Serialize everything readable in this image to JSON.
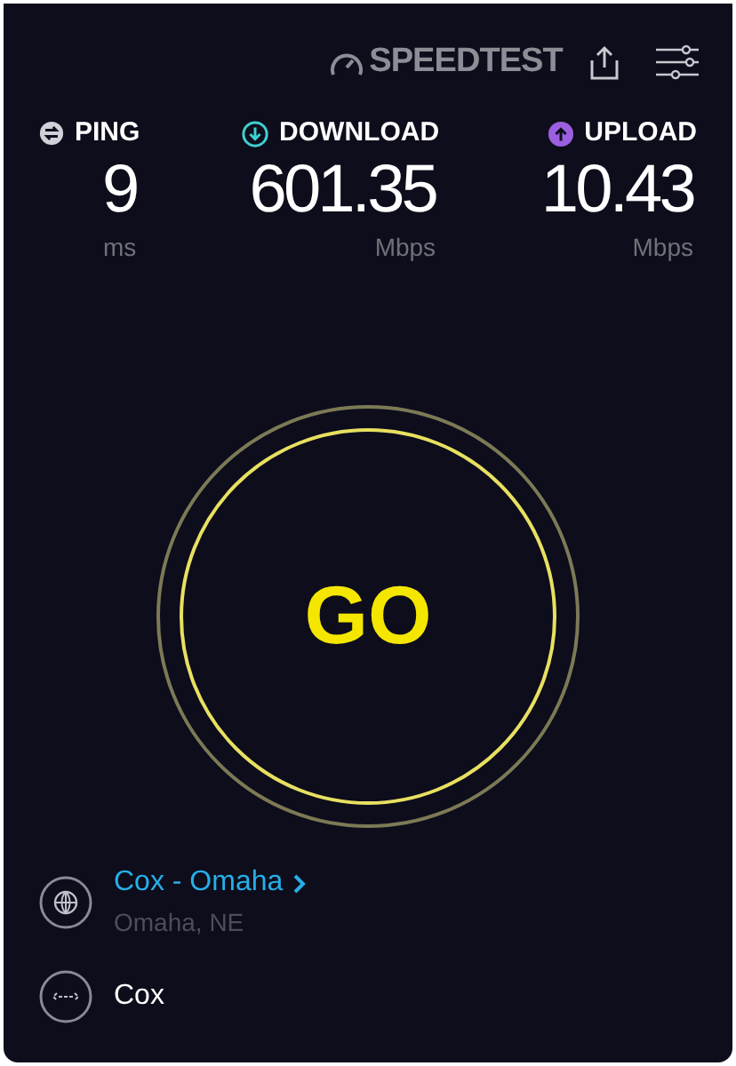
{
  "header": {
    "logo": "SPEEDTEST"
  },
  "metrics": [
    {
      "kind": "ping",
      "label": "PING",
      "value": "9",
      "unit": "ms"
    },
    {
      "kind": "download",
      "label": "DOWNLOAD",
      "value": "601.35",
      "unit": "Mbps"
    },
    {
      "kind": "upload",
      "label": "UPLOAD",
      "value": "10.43",
      "unit": "Mbps"
    }
  ],
  "go_button": {
    "label": "GO"
  },
  "server": {
    "name": "Cox - Omaha",
    "location": "Omaha, NE"
  },
  "provider": {
    "name": "Cox"
  }
}
